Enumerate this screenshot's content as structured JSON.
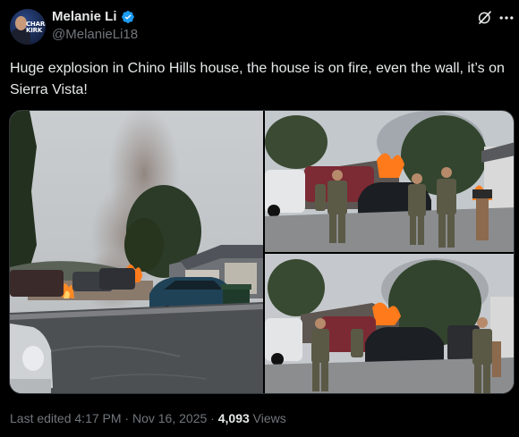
{
  "author": {
    "name": "Melanie Li",
    "handle": "@MelanieLi18",
    "avatar_text": "CHARLIE KIRK",
    "verified": true
  },
  "tweet": {
    "text": "Huge explosion in Chino Hills house, the house is on fire, even the wall, it’s on Sierra Vista!"
  },
  "media": {
    "count": 3,
    "photos": [
      "explosion-smoke-street-photo",
      "deputies-fire-photo-1",
      "deputies-fire-photo-2"
    ]
  },
  "footer": {
    "edited_prefix": "Last edited",
    "time": "4:17 PM",
    "separator": "·",
    "date": "Nov 16, 2025",
    "views_count": "4,093",
    "views_label": "Views"
  },
  "icons": [
    "verified-badge-icon",
    "grok-icon",
    "more-options-icon"
  ],
  "colors": {
    "background": "#000000",
    "text": "#e7e9ea",
    "secondary": "#71767b",
    "verified": "#1d9bf0"
  }
}
